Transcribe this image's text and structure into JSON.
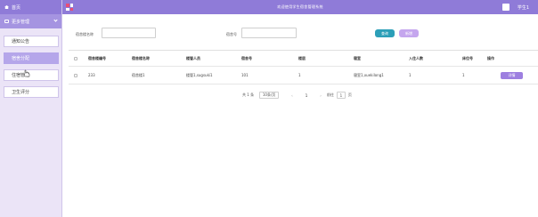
{
  "sidebar": {
    "home_label": "首页",
    "group_label": "更多管理",
    "items": [
      {
        "label": "通知公告"
      },
      {
        "label": "宿舍分配"
      },
      {
        "label": "住宿管理"
      },
      {
        "label": "卫生评分"
      }
    ]
  },
  "topbar": {
    "system_title": "欢迎使用学生宿舍管理系统",
    "user_name": "学生1"
  },
  "search": {
    "building_label": "宿舍楼名称",
    "building_value": "",
    "room_label": "宿舍号",
    "room_value": "",
    "query_button": "查询",
    "add_button": "新增"
  },
  "table": {
    "headers": [
      "宿舍楼编号",
      "宿舍楼名称",
      "楼管人员",
      "宿舍号",
      "楼层",
      "寝室",
      "入住人数",
      "床位号",
      "操作"
    ],
    "rows": [
      {
        "cells": [
          "233",
          "宿舍楼1",
          "楼管1,sugsuki1",
          "101",
          "1",
          "寝室1,xuekilong1",
          "1",
          "1"
        ],
        "action": "详情"
      }
    ]
  },
  "pagination": {
    "total_text": "共 1 条",
    "page_size": "10条/页",
    "prev": "‹",
    "current_page": "1",
    "next": "›",
    "goto_label": "前往",
    "goto_value": "1",
    "goto_suffix": "页"
  },
  "colors": {
    "header_bg": "#8f7bd8",
    "sidebar_bg": "#ebe4f7",
    "query_button": "#2c9fb8",
    "add_button": "#c5a6ee",
    "detail_button": "#9d7fe0"
  }
}
